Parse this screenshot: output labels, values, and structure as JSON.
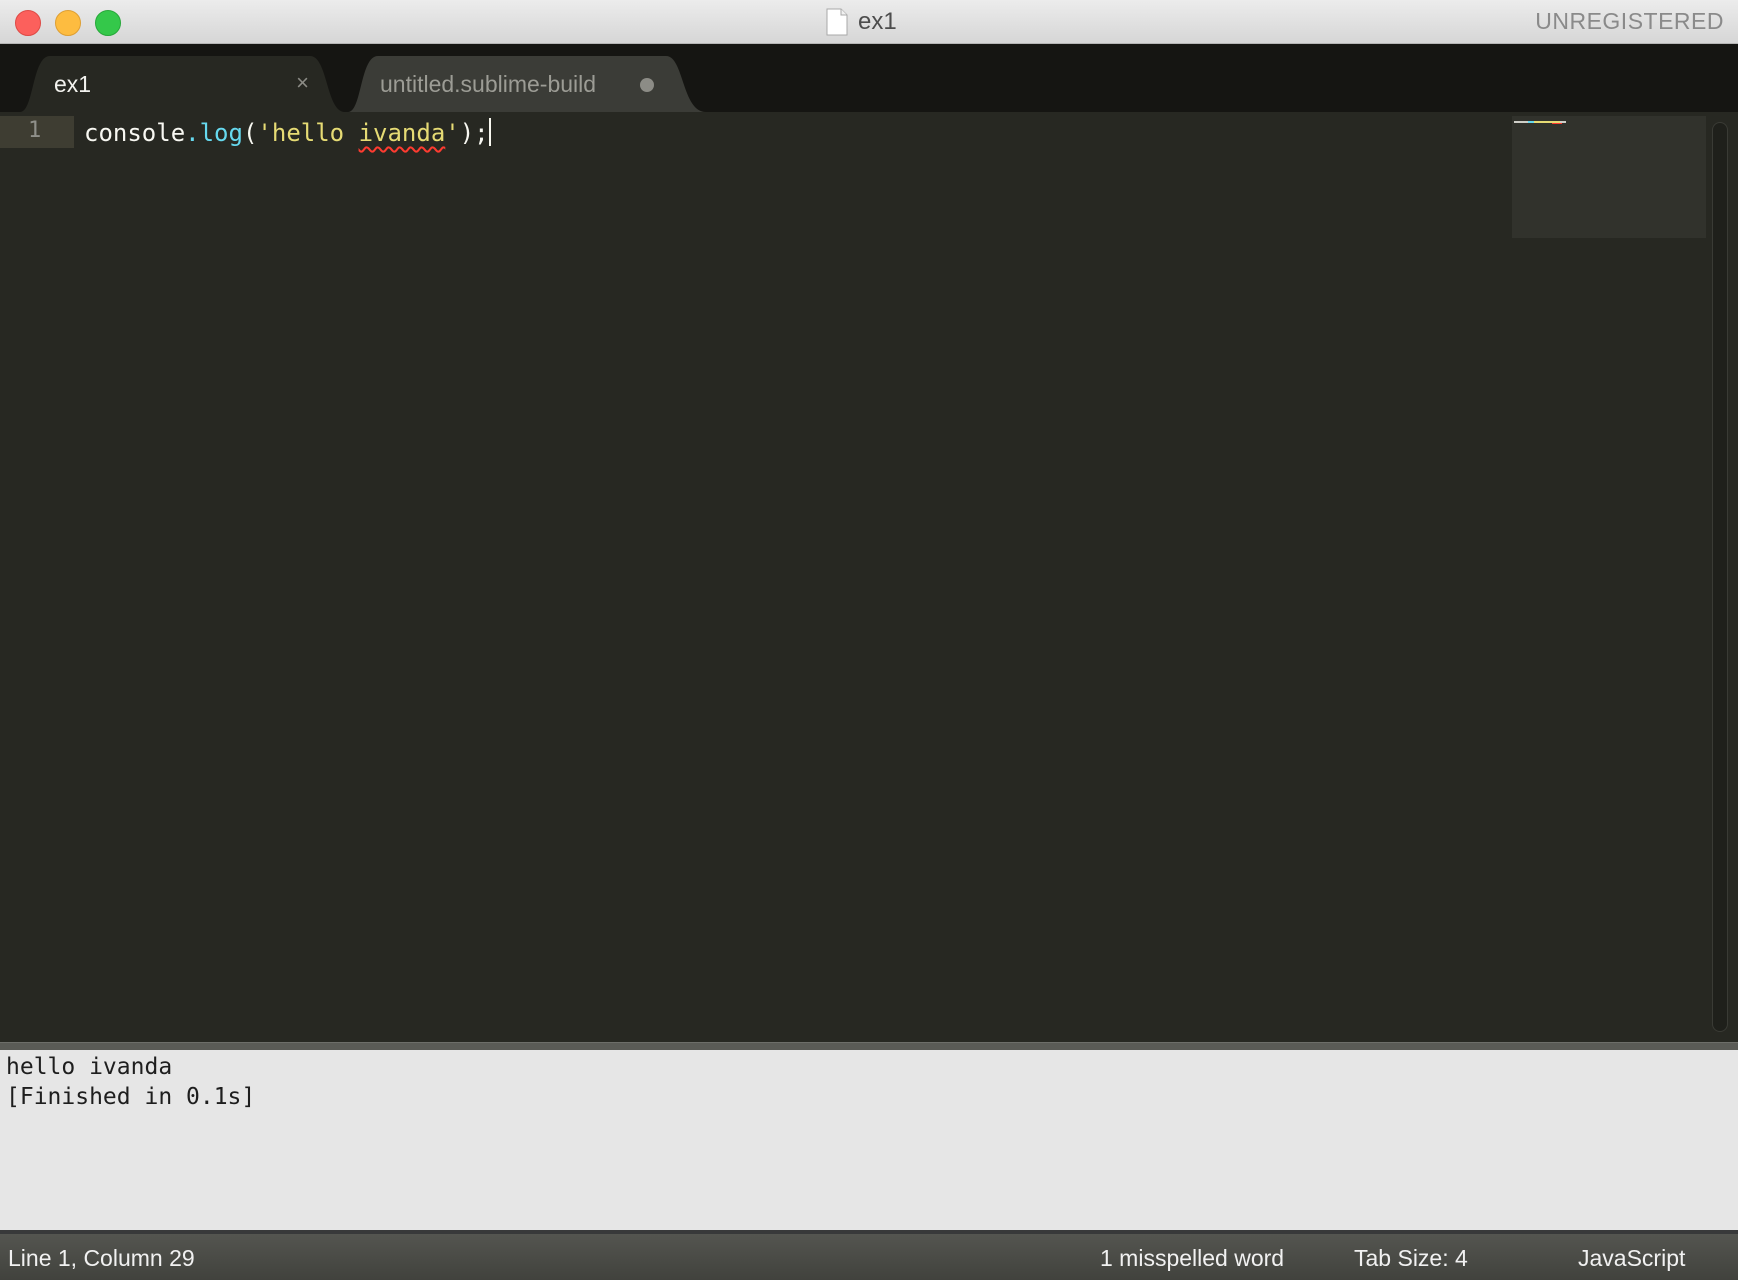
{
  "window": {
    "title": "ex1",
    "registration": "UNREGISTERED"
  },
  "tabs": [
    {
      "label": "ex1",
      "close_glyph": "×",
      "active": true
    },
    {
      "label": "untitled.sublime-build",
      "active": false,
      "modified": true
    }
  ],
  "editor": {
    "line_number": "1",
    "code": {
      "object": "console",
      "dot": ".",
      "method": "log",
      "open_paren": "(",
      "quote_open": "'",
      "string_part1": "hello ",
      "string_misspelled": "ivanda",
      "quote_close": "'",
      "close": ");"
    },
    "syntax_colors": {
      "identifier": "#f8f8f2",
      "function": "#66d9ef",
      "string": "#e6db74",
      "background": "#272822"
    }
  },
  "output": {
    "lines": [
      "hello ivanda",
      "[Finished in 0.1s]"
    ]
  },
  "statusbar": {
    "position": "Line 1, Column 29",
    "spelling": "1 misspelled word",
    "tab_size": "Tab Size: 4",
    "syntax": "JavaScript"
  }
}
